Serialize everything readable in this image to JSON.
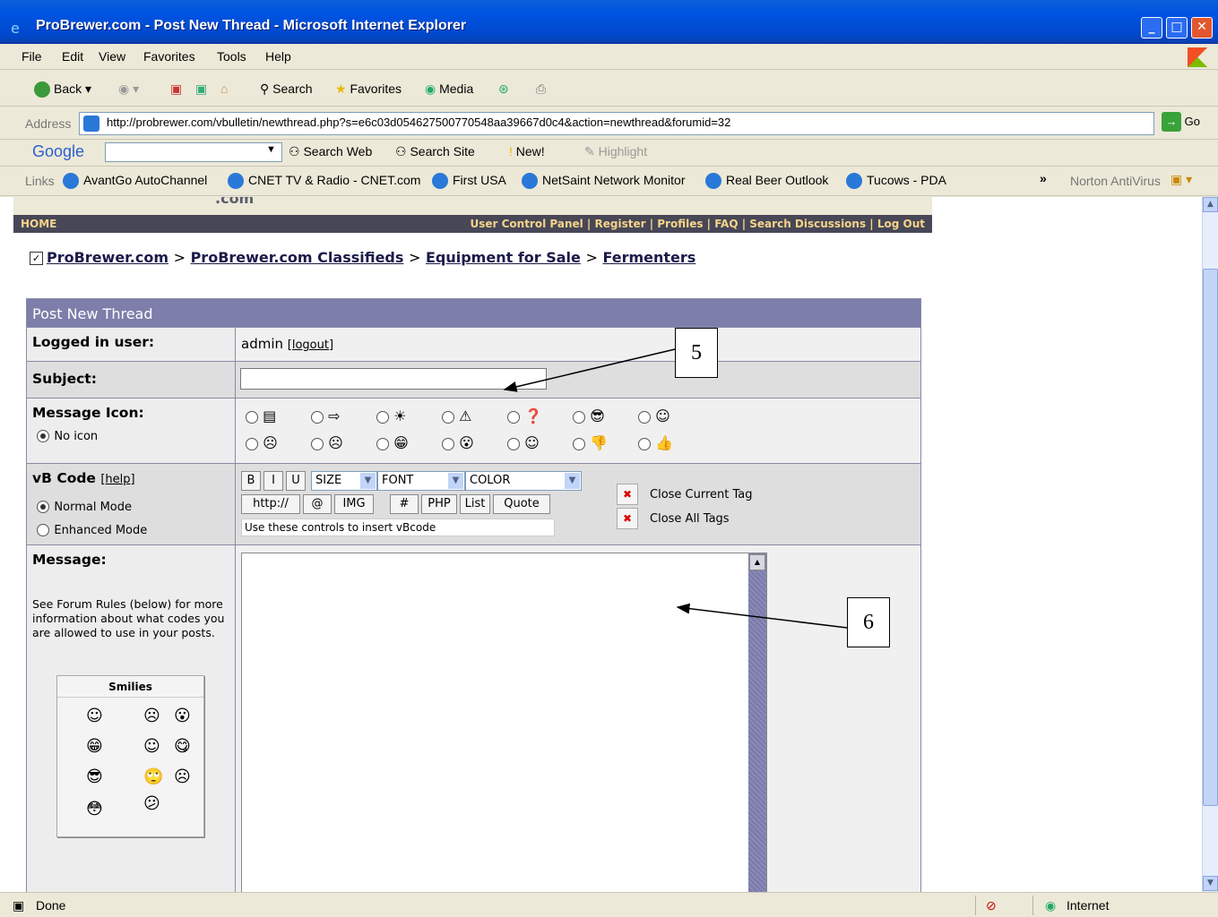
{
  "window": {
    "title": "ProBrewer.com - Post New Thread - Microsoft Internet Explorer"
  },
  "menubar": {
    "items": [
      "File",
      "Edit",
      "View",
      "Favorites",
      "Tools",
      "Help"
    ]
  },
  "toolbar": {
    "back": "Back",
    "search": "Search",
    "favorites": "Favorites",
    "media": "Media"
  },
  "address": {
    "label": "Address",
    "url": "http://probrewer.com/vbulletin/newthread.php?s=e6c03d054627500770548aa39667d0c4&action=newthread&forumid=32",
    "go": "Go"
  },
  "google": {
    "logo": "Google",
    "search_web": "Search Web",
    "search_site": "Search Site",
    "new": "New!",
    "highlight": "Highlight"
  },
  "links": {
    "label": "Links",
    "items": [
      "AvantGo AutoChannel",
      "CNET TV & Radio - CNET.com",
      "First USA",
      "NetSaint Network Monitor",
      "Real Beer Outlook",
      "Tucows - PDA"
    ],
    "more": "»",
    "norton": "Norton AntiVirus"
  },
  "site": {
    "logo_fragment": ".com",
    "home": "HOME",
    "nav": "User Control Panel | Register | Profiles | FAQ | Search Discussions | Log Out",
    "breadcrumb": [
      "ProBrewer.com",
      "ProBrewer.com Classifieds",
      "Equipment for Sale",
      "Fermenters"
    ],
    "breadcrumb_sep": ">"
  },
  "form": {
    "header": "Post New Thread",
    "logged_label": "Logged in user:",
    "user": "admin",
    "logout": "[logout]",
    "subject_label": "Subject:",
    "subject_value": "",
    "icon_label": "Message Icon:",
    "no_icon": "No icon",
    "icons_row1": [
      "▤",
      "⇨",
      "☀",
      "⚠",
      "❓",
      "😎",
      "☺"
    ],
    "icons_row2": [
      "☹",
      "☹",
      "😁",
      "😮",
      "☺",
      "👎",
      "👍"
    ],
    "vbcode_label": "vB Code",
    "help": "[help]",
    "normal_mode": "Normal Mode",
    "enhanced_mode": "Enhanced Mode",
    "btn_b": "B",
    "btn_i": "I",
    "btn_u": "U",
    "size": "SIZE",
    "font": "FONT",
    "color": "COLOR",
    "btn_http": "http://",
    "btn_at": "@",
    "btn_img": "IMG",
    "btn_hash": "#",
    "btn_php": "PHP",
    "btn_list": "List",
    "btn_quote": "Quote",
    "hint": "Use these controls to insert vBcode",
    "close_current": "Close Current Tag",
    "close_all": "Close All Tags",
    "message_label": "Message:",
    "message_note": "See Forum Rules (below) for more information about what codes you are allowed to use in your posts.",
    "smilies_title": "Smilies"
  },
  "callouts": {
    "five": "5",
    "six": "6"
  },
  "status": {
    "text": "Done",
    "zone": "Internet"
  }
}
